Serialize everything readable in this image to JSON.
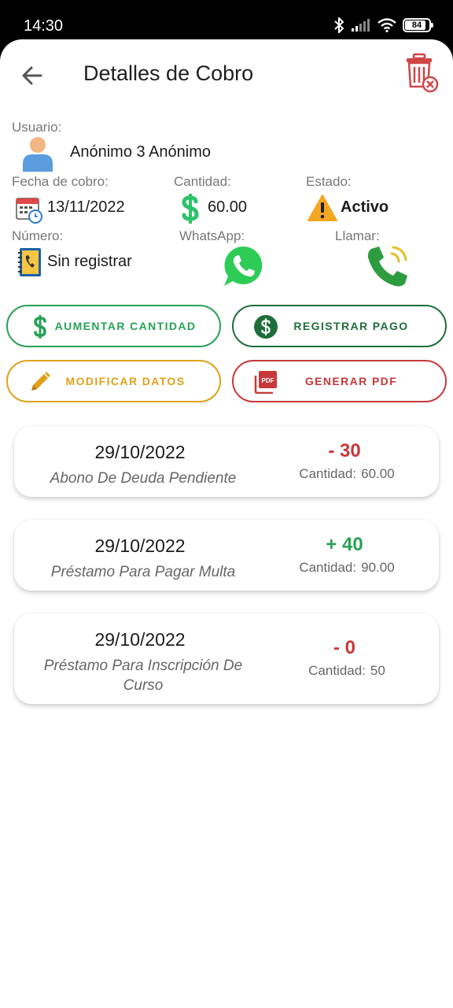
{
  "status_bar": {
    "time": "14:30",
    "battery": "84"
  },
  "header": {
    "title": "Detalles de Cobro"
  },
  "user": {
    "label": "Usuario:",
    "name": "Anónimo 3  Anónimo"
  },
  "info": {
    "date_label": "Fecha de cobro:",
    "date_value": "13/11/2022",
    "amount_label": "Cantidad:",
    "amount_value": "60.00",
    "status_label": "Estado:",
    "status_value": "Activo",
    "number_label": "Número:",
    "number_value": "Sin registrar",
    "whatsapp_label": "WhatsApp:",
    "call_label": "Llamar:"
  },
  "buttons": {
    "increase": "AUMENTAR CANTIDAD",
    "register": "REGISTRAR PAGO",
    "modify": "MODIFICAR DATOS",
    "pdf": "GENERAR PDF"
  },
  "colors": {
    "green": "#27a255",
    "dark_green": "#1e6e3a",
    "orange": "#e0a018",
    "red": "#c8383a"
  },
  "quantity_label": "Cantidad:",
  "movements": [
    {
      "date": "29/10/2022",
      "description": "Abono De Deuda Pendiente",
      "amount": "- 30",
      "quantity": "60.00",
      "type": "negative"
    },
    {
      "date": "29/10/2022",
      "description": "Préstamo Para Pagar Multa",
      "amount": "+ 40",
      "quantity": "90.00",
      "type": "positive"
    },
    {
      "date": "29/10/2022",
      "description": "Préstamo Para Inscripción De Curso",
      "amount": "- 0",
      "quantity": "50",
      "type": "negative"
    }
  ]
}
